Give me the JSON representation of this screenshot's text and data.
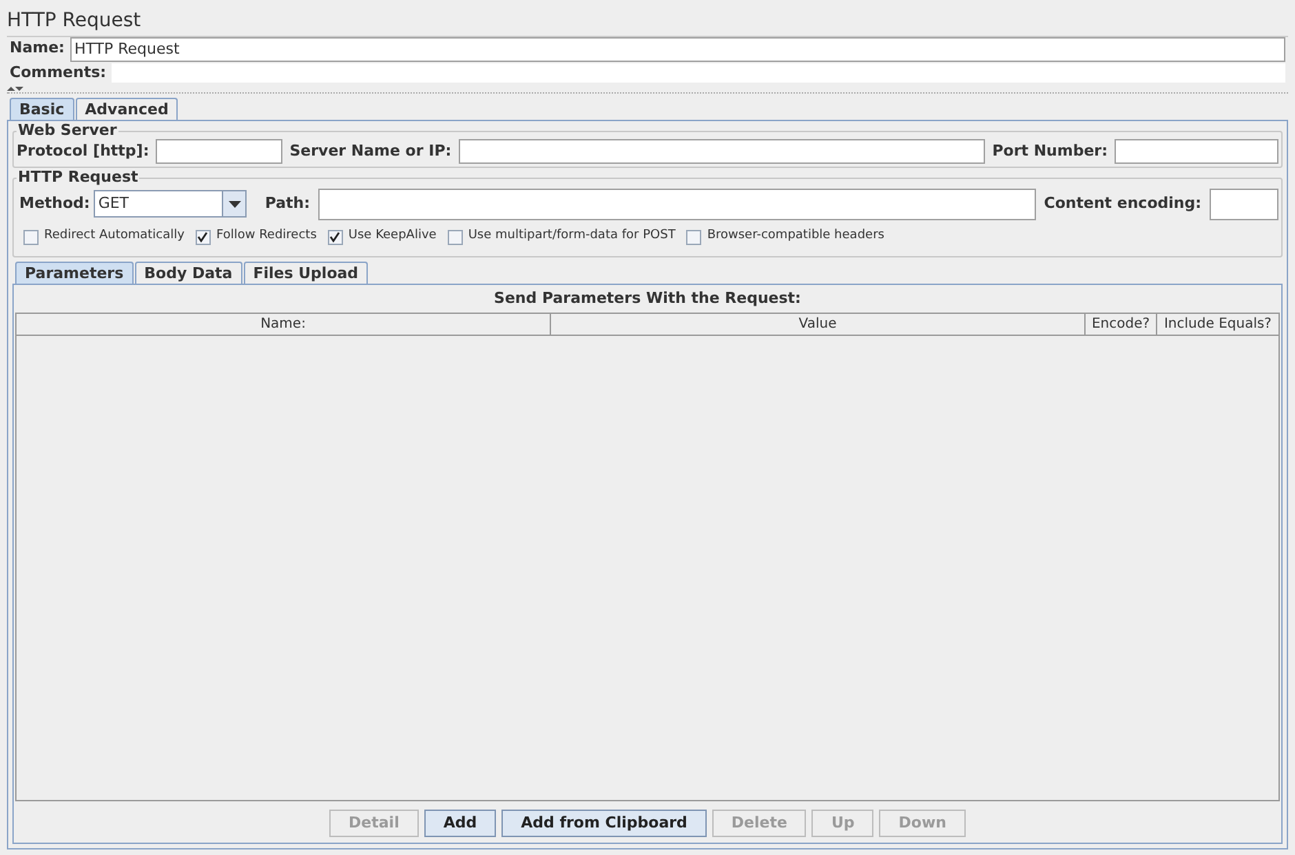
{
  "title": "HTTP Request",
  "name_field": {
    "label": "Name:",
    "value": "HTTP Request"
  },
  "comments_field": {
    "label": "Comments:"
  },
  "tabs": [
    {
      "label": "Basic",
      "selected": true
    },
    {
      "label": "Advanced",
      "selected": false
    }
  ],
  "web_server": {
    "title": "Web Server",
    "fields": [
      {
        "label": "Protocol [http]:"
      },
      {
        "label": "Server Name or IP:"
      },
      {
        "label": "Port Number:"
      }
    ]
  },
  "http_request": {
    "title": "HTTP Request",
    "method": {
      "label": "Method:",
      "value": "GET"
    },
    "path": {
      "label": "Path:"
    },
    "encoding": {
      "label": "Content encoding:"
    },
    "checkboxes": [
      {
        "label": "Redirect Automatically",
        "checked": false
      },
      {
        "label": "Follow Redirects",
        "checked": true
      },
      {
        "label": "Use KeepAlive",
        "checked": true
      },
      {
        "label": "Use multipart/form-data for POST",
        "checked": false
      },
      {
        "label": "Browser-compatible headers",
        "checked": false
      }
    ]
  },
  "sub_tabs": [
    {
      "label": "Parameters",
      "selected": true
    },
    {
      "label": "Body Data",
      "selected": false
    },
    {
      "label": "Files Upload",
      "selected": false
    }
  ],
  "parameters": {
    "caption": "Send Parameters With the Request:",
    "columns": [
      "Name:",
      "Value",
      "Encode?",
      "Include Equals?"
    ]
  },
  "buttons": [
    {
      "label": "Detail",
      "disabled": true
    },
    {
      "label": "Add",
      "disabled": false
    },
    {
      "label": "Add from Clipboard",
      "disabled": false
    },
    {
      "label": "Delete",
      "disabled": true
    },
    {
      "label": "Up",
      "disabled": true
    },
    {
      "label": "Down",
      "disabled": true
    }
  ]
}
